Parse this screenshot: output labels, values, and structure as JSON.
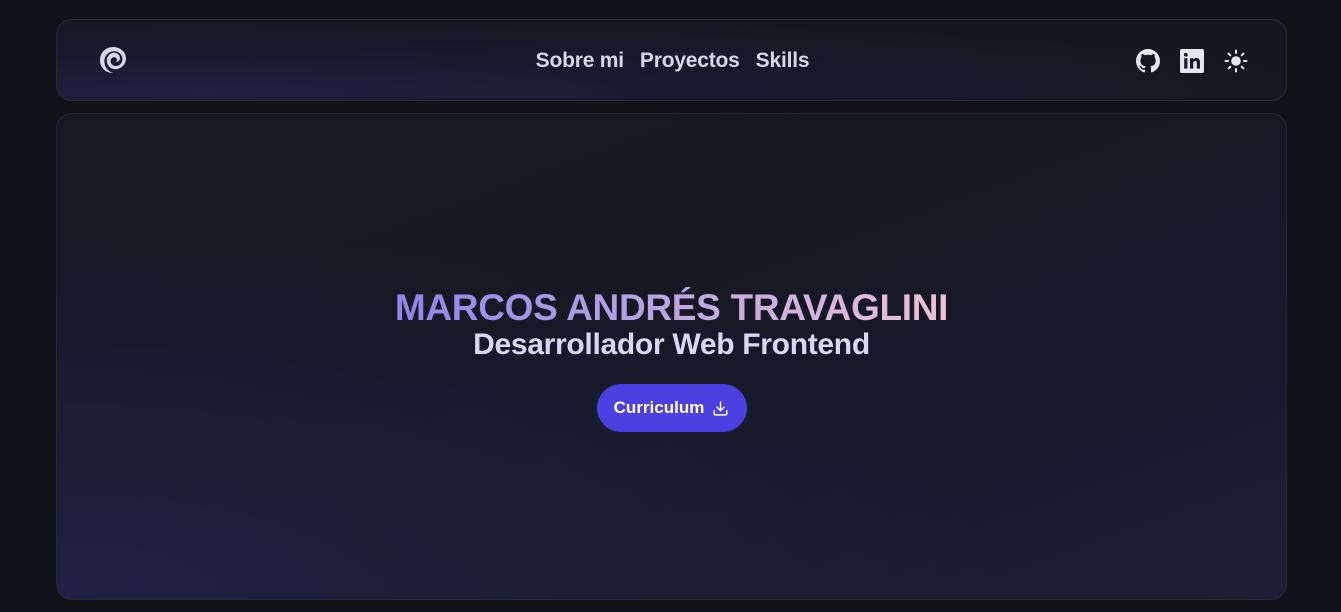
{
  "nav": {
    "logo_icon": "spiral-logo-icon",
    "links": [
      {
        "label": "Sobre mi"
      },
      {
        "label": "Proyectos"
      },
      {
        "label": "Skills"
      }
    ],
    "icons": [
      "github-icon",
      "linkedin-icon",
      "sun-icon"
    ]
  },
  "hero": {
    "name": "MARCOS ANDRÉS TRAVAGLINI",
    "role": "Desarrollador Web Frontend",
    "cv_button_label": "Curriculum",
    "cv_button_icon": "download-icon"
  },
  "colors": {
    "background": "#121219",
    "accent": "#4d40e0",
    "gradient_start": "#8f86e9",
    "gradient_end": "#efc2d6",
    "nav_text": "#d6d8e6"
  }
}
